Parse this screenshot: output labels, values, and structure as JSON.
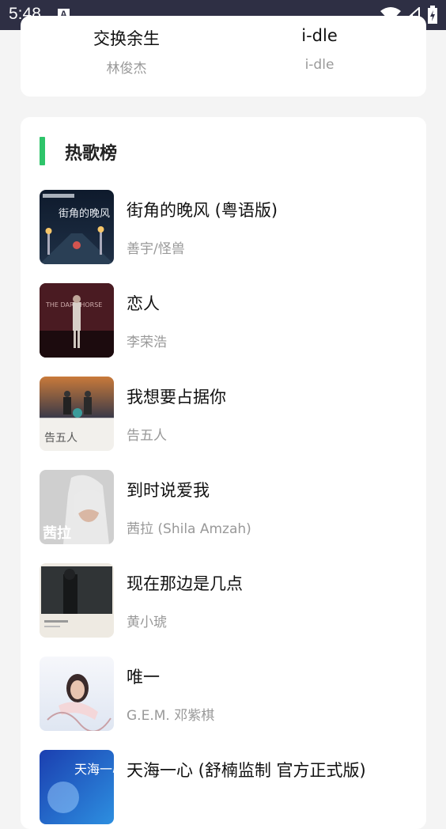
{
  "status_bar": {
    "time": "5:48",
    "notification_badge": "A"
  },
  "recommend": {
    "items": [
      {
        "title": "交换余生",
        "artist": "林俊杰"
      },
      {
        "title": "i-dle",
        "artist": "i-dle"
      }
    ]
  },
  "hot_chart": {
    "title": "热歌榜",
    "accent_color": "#2ec46a",
    "songs": [
      {
        "title": "街角的晚风 (粤语版)",
        "artist": "善宇/怪兽",
        "cover_text": "街角的晚风"
      },
      {
        "title": "恋人",
        "artist": "李荣浩",
        "cover_text": "THE DARK HORSE"
      },
      {
        "title": "我想要占据你",
        "artist": "告五人",
        "cover_text": "告五人"
      },
      {
        "title": "到时说爱我",
        "artist": "茜拉 (Shila Amzah)",
        "cover_text": "茜拉"
      },
      {
        "title": "现在那边是几点",
        "artist": "黄小琥",
        "cover_text": ""
      },
      {
        "title": "唯一",
        "artist": "G.E.M. 邓紫棋",
        "cover_text": ""
      },
      {
        "title": "天海一心 (舒楠监制 官方正式版)",
        "artist": "",
        "cover_text": "天海一心"
      }
    ]
  }
}
